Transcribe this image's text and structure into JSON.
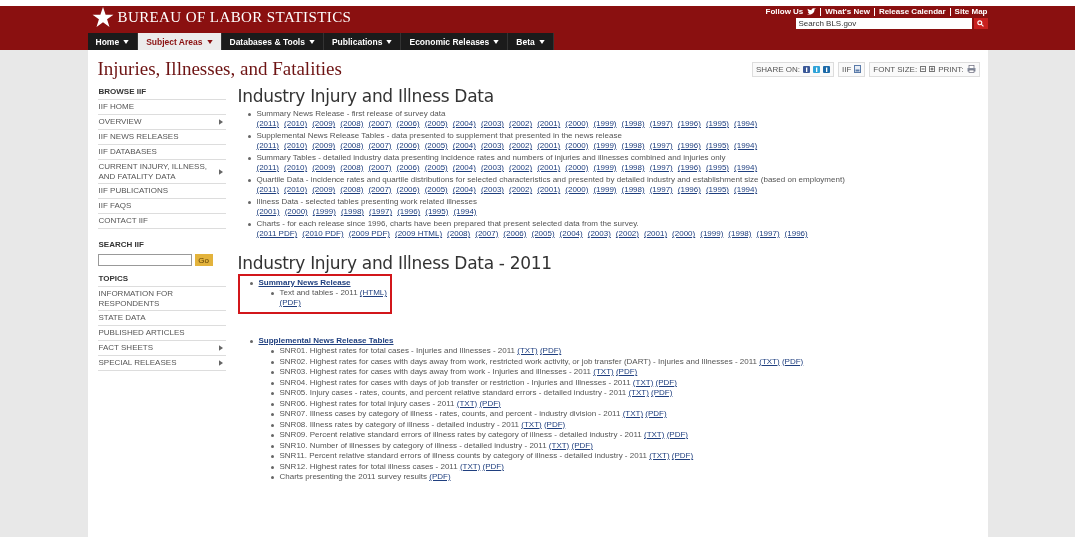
{
  "header": {
    "logo_text": "BUREAU OF LABOR STATISTICS",
    "top_links": [
      "Follow Us",
      "What's New",
      "Release Calendar",
      "Site Map"
    ],
    "search": {
      "placeholder": "Search BLS.gov"
    }
  },
  "nav": [
    {
      "label": "Home",
      "selected": false
    },
    {
      "label": "Subject Areas",
      "selected": true
    },
    {
      "label": "Databases & Tools",
      "selected": false
    },
    {
      "label": "Publications",
      "selected": false
    },
    {
      "label": "Economic Releases",
      "selected": false
    },
    {
      "label": "Beta",
      "selected": false
    }
  ],
  "page_title": "Injuries, Illnesses, and Fatalities",
  "share_bar": {
    "share_label": "SHARE ON:",
    "pdf_label": "IIF",
    "font_size_label": "FONT SIZE:",
    "print_label": "PRINT:"
  },
  "sidebar": {
    "browse_heading": "BROWSE IIF",
    "browse_items": [
      {
        "label": "IIF HOME",
        "submenu": false
      },
      {
        "label": "OVERVIEW",
        "submenu": true
      },
      {
        "label": "IIF NEWS RELEASES",
        "submenu": false
      },
      {
        "label": "IIF DATABASES",
        "submenu": false
      },
      {
        "label": "CURRENT INJURY, ILLNESS, AND FATALITY DATA",
        "submenu": true
      },
      {
        "label": "IIF PUBLICATIONS",
        "submenu": false
      },
      {
        "label": "IIF FAQS",
        "submenu": false
      },
      {
        "label": "CONTACT IIF",
        "submenu": false
      }
    ],
    "search_heading": "SEARCH IIF",
    "search_button": "Go",
    "topics_heading": "TOPICS",
    "topic_items": [
      {
        "label": "INFORMATION FOR RESPONDENTS",
        "submenu": false
      },
      {
        "label": "STATE DATA",
        "submenu": false
      },
      {
        "label": "PUBLISHED ARTICLES",
        "submenu": false
      },
      {
        "label": "FACT SHEETS",
        "submenu": true
      },
      {
        "label": "SPECIAL RELEASES",
        "submenu": true
      }
    ]
  },
  "sections": [
    {
      "kind": "releases",
      "title": "Industry Injury and Illness Data",
      "items": [
        {
          "text": "Summary News Release - first release of survey data",
          "links": [
            "(2011)",
            "(2010)",
            "(2009)",
            "(2008)",
            "(2007)",
            "(2006)",
            "(2005)",
            "(2004)",
            "(2003)",
            "(2002)",
            "(2001)",
            "(2000)",
            "(1999)",
            "(1998)",
            "(1997)",
            "(1996)",
            "(1995)",
            "(1994)"
          ]
        },
        {
          "text": "Supplemental News Release Tables - data presented to supplement that presented in the news release",
          "links": [
            "(2011)",
            "(2010)",
            "(2009)",
            "(2008)",
            "(2007)",
            "(2006)",
            "(2005)",
            "(2004)",
            "(2003)",
            "(2002)",
            "(2001)",
            "(2000)",
            "(1999)",
            "(1998)",
            "(1997)",
            "(1996)",
            "(1995)",
            "(1994)"
          ]
        },
        {
          "text": "Summary Tables - detailed industry data presenting incidence rates and numbers of injuries and illnesses combined and injuries only",
          "links": [
            "(2011)",
            "(2010)",
            "(2009)",
            "(2008)",
            "(2007)",
            "(2006)",
            "(2005)",
            "(2004)",
            "(2003)",
            "(2002)",
            "(2001)",
            "(2000)",
            "(1999)",
            "(1998)",
            "(1997)",
            "(1996)",
            "(1995)",
            "(1994)"
          ]
        },
        {
          "text": "Quartile Data - incidence rates and quartile distributions for selected characteristics and presented by detailed industry and establishment size (based on employment)",
          "links": [
            "(2011)",
            "(2010)",
            "(2009)",
            "(2008)",
            "(2007)",
            "(2006)",
            "(2005)",
            "(2004)",
            "(2003)",
            "(2002)",
            "(2001)",
            "(2000)",
            "(1999)",
            "(1998)",
            "(1997)",
            "(1996)",
            "(1995)",
            "(1994)"
          ]
        },
        {
          "text": "Illness Data - selected tables presenting work related illnesses",
          "links": [
            "(2001)",
            "(2000)",
            "(1999)",
            "(1998)",
            "(1997)",
            "(1996)",
            "(1995)",
            "(1994)"
          ]
        },
        {
          "text": "Charts - for each release since 1996, charts have been prepared that present selected data from the survey.",
          "links": [
            "(2011 PDF)",
            "(2010 PDF)",
            "(2009 PDF)",
            "(2009 HTML)",
            "(2008)",
            "(2007)",
            "(2006)",
            "(2005)",
            "(2004)",
            "(2003)",
            "(2002)",
            "(2001)",
            "(2000)",
            "(1999)",
            "(1998)",
            "(1997)",
            "(1996)"
          ]
        }
      ]
    },
    {
      "kind": "tables",
      "title": "Industry Injury and Illness Data - 2011",
      "groups": [
        {
          "title": "Summary News Release",
          "highlighted": true,
          "items": [
            {
              "text": "Text and tables - 2011",
              "links": [
                "(HTML)",
                "(PDF)"
              ]
            }
          ]
        },
        {
          "title": "Supplemental News Release Tables",
          "highlighted": false,
          "items": [
            {
              "text": "SNR01. Highest rates for total cases - Injuries and Illnesses - 2011",
              "links": [
                "(TXT)",
                "(PDF)"
              ]
            },
            {
              "text": "SNR02. Highest rates for cases with days away from work, restricted work activity, or job transfer (DART) - Injuries and Illnesses - 2011",
              "links": [
                "(TXT)",
                "(PDF)"
              ]
            },
            {
              "text": "SNR03. Highest rates for cases with days away from work - Injuries and illnesses - 2011",
              "links": [
                "(TXT)",
                "(PDF)"
              ]
            },
            {
              "text": "SNR04. Highest rates for cases with days of job transfer or restriction - Injuries and Illnesses - 2011",
              "links": [
                "(TXT)",
                "(PDF)"
              ]
            },
            {
              "text": "SNR05. Injury cases - rates, counts, and percent relative standard errors - detailed industry - 2011",
              "links": [
                "(TXT)",
                "(PDF)"
              ]
            },
            {
              "text": "SNR06. Highest rates for total injury cases - 2011",
              "links": [
                "(TXT)",
                "(PDF)"
              ]
            },
            {
              "text": "SNR07. Illness cases by category of illness - rates, counts, and percent - industry division - 2011",
              "links": [
                "(TXT)",
                "(PDF)"
              ]
            },
            {
              "text": "SNR08. Illness rates by category of illness - detailed industry - 2011",
              "links": [
                "(TXT)",
                "(PDF)"
              ]
            },
            {
              "text": "SNR09. Percent relative standard errors of illness rates by category of illness - detailed industry - 2011",
              "links": [
                "(TXT)",
                "(PDF)"
              ]
            },
            {
              "text": "SNR10. Number of illnesses by category of illness - detailed industry - 2011",
              "links": [
                "(TXT)",
                "(PDF)"
              ]
            },
            {
              "text": "SNR11. Percent relative standard errors of illness counts by category of illness - detailed industry - 2011",
              "links": [
                "(TXT)",
                "(PDF)"
              ]
            },
            {
              "text": "SNR12. Highest rates for total illness cases - 2011",
              "links": [
                "(TXT)",
                "(PDF)"
              ]
            },
            {
              "text": "Charts presenting the 2011 survey results",
              "links": [
                "(PDF)"
              ]
            }
          ]
        }
      ]
    }
  ]
}
